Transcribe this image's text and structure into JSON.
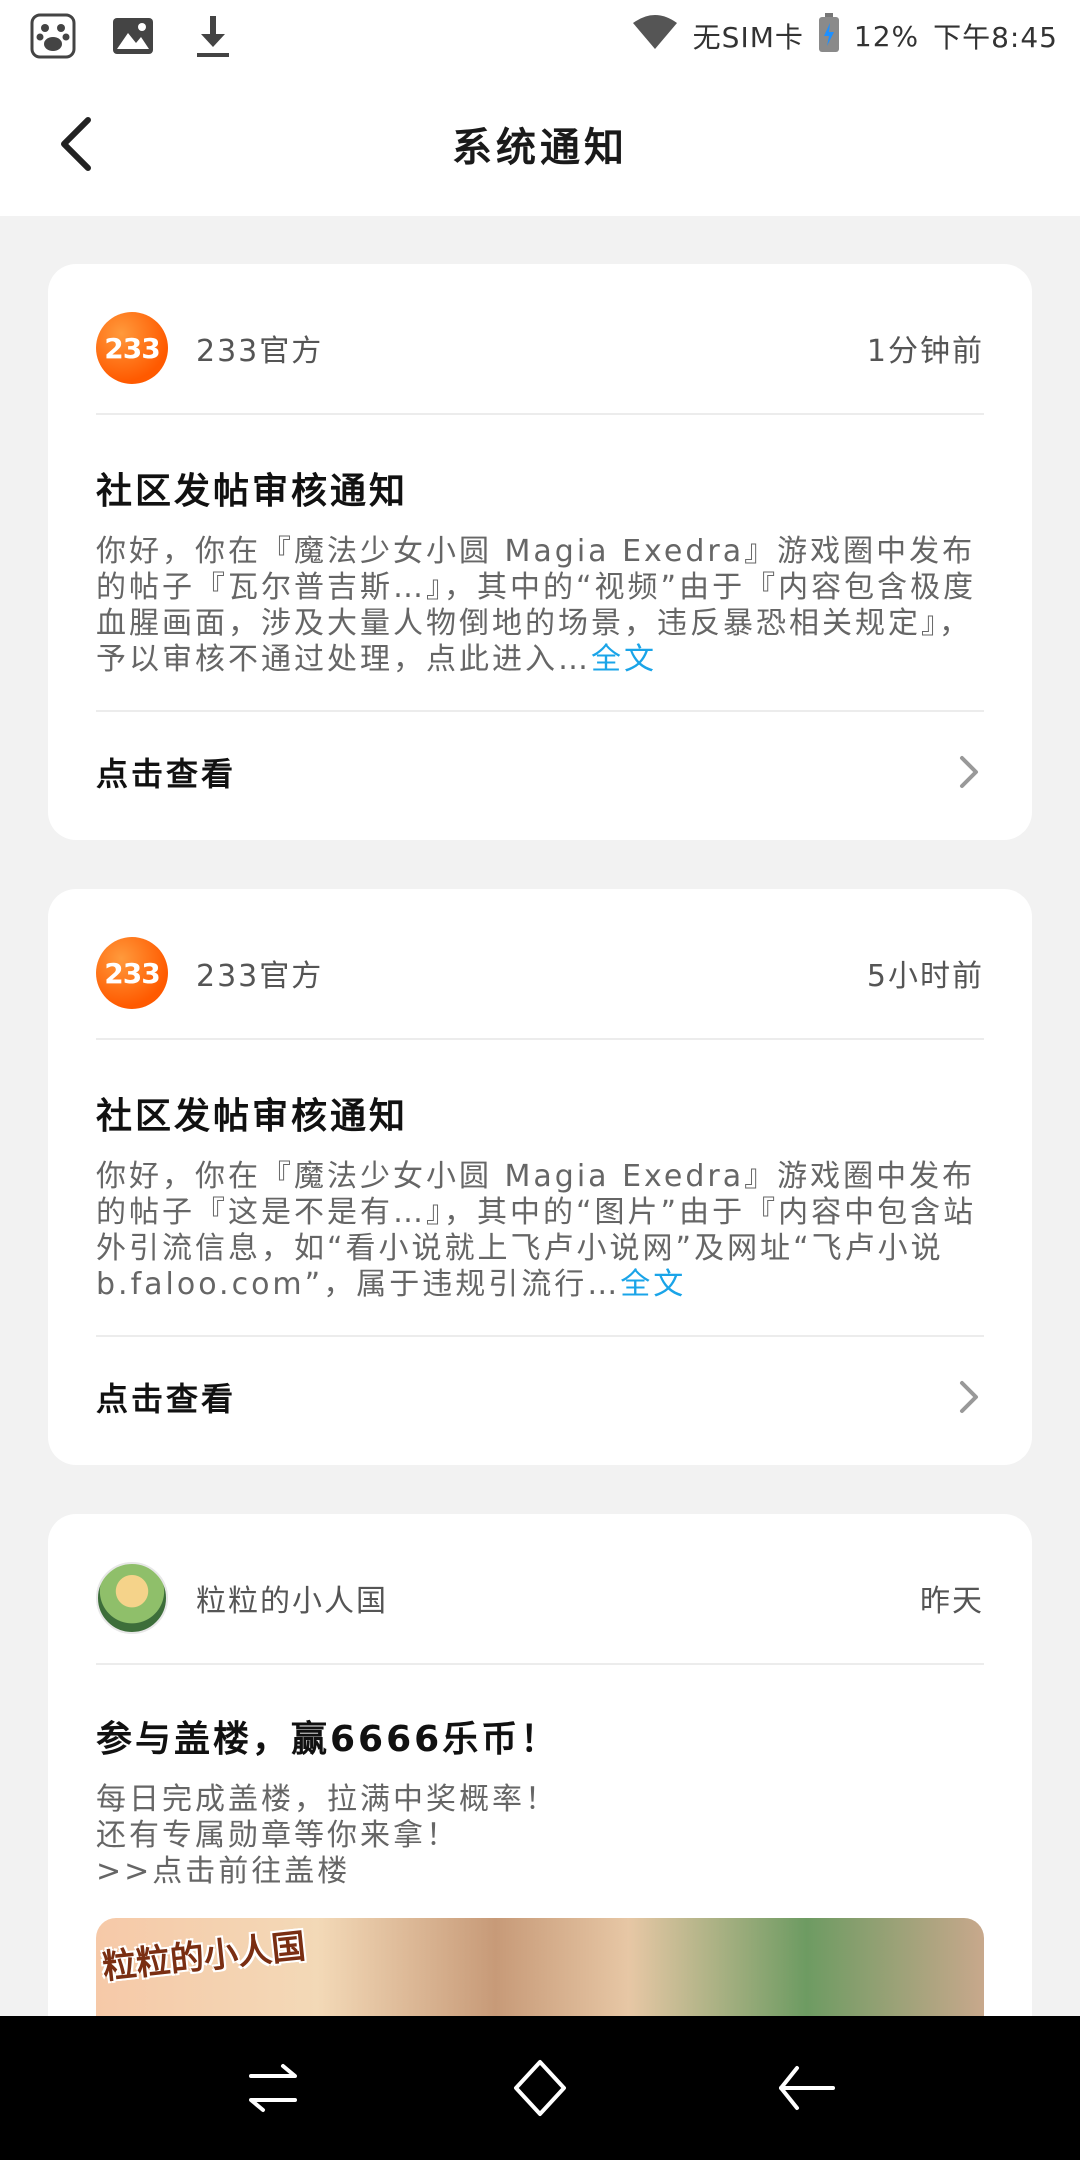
{
  "status_bar": {
    "carrier": "无SIM卡",
    "battery": "12%",
    "time": "下午8:45"
  },
  "header": {
    "title": "系统通知"
  },
  "notifications": [
    {
      "sender": "233官方",
      "avatar_text": "233",
      "time": "1分钟前",
      "title": "社区发帖审核通知",
      "body": "你好，你在『魔法少女小圆 Magia Exedra』游戏圈中发布的帖子『瓦尔普吉斯…』，其中的“视频”由于『内容包含极度血腥画面，涉及大量人物倒地的场景，违反暴恐相关规定』，予以审核不通过处理，点此进入…",
      "more_link": "全文",
      "action_label": "点击查看"
    },
    {
      "sender": "233官方",
      "avatar_text": "233",
      "time": "5小时前",
      "title": "社区发帖审核通知",
      "body": "你好，你在『魔法少女小圆 Magia Exedra』游戏圈中发布的帖子『这是不是有…』，其中的“图片”由于『内容中包含站外引流信息，如“看小说就上飞卢小说网”及网址“飞卢小说 b.faloo.com”，属于违规引流行…",
      "more_link": "全文",
      "action_label": "点击查看"
    },
    {
      "sender": "粒粒的小人国",
      "time": "昨天",
      "title": "参与盖楼，赢6666乐币！",
      "body_lines": [
        "每日完成盖楼，拉满中奖概率！",
        "还有专属勋章等你来拿！",
        ">>点击前往盖楼"
      ],
      "banner_logo": "粒粒的小人国"
    }
  ],
  "colors": {
    "accent_link": "#1aa4e8",
    "avatar_orange": "#ff6a00",
    "background": "#f2f2f2"
  },
  "icons": {
    "status_left": [
      "baidu-paw-icon",
      "image-icon",
      "download-icon"
    ],
    "status_right": [
      "wifi-icon",
      "battery-icon"
    ],
    "nav": [
      "back-arrow-icon"
    ],
    "system": [
      "recents-icon",
      "home-icon",
      "back-icon"
    ]
  }
}
